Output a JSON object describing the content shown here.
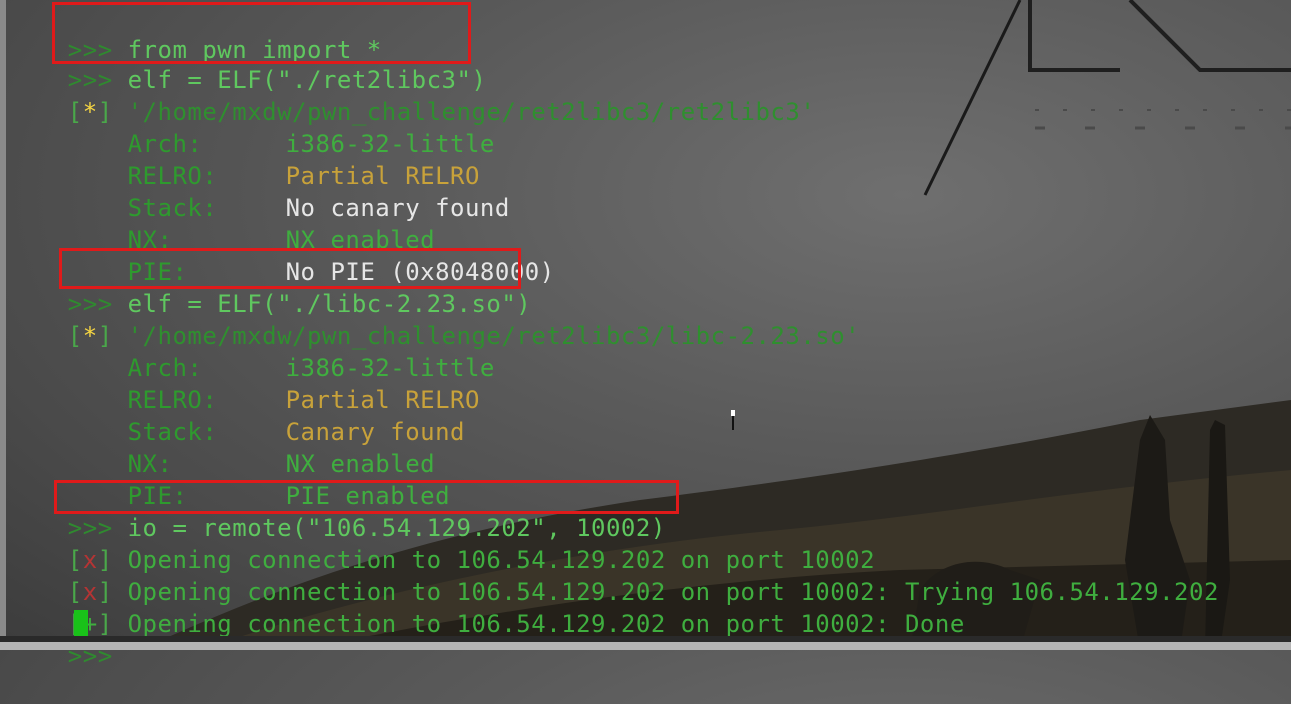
{
  "terminal": {
    "prompt": ">>>",
    "lines": [
      {
        "cmd": "from pwn import *"
      },
      {
        "cmd": "elf = ELF(\"./ret2libc3\")"
      },
      {
        "path": "'/home/mxdw/pwn_challenge/ret2libc3/ret2libc3'"
      },
      {
        "k": "Arch:",
        "v": "i386-32-little"
      },
      {
        "k": "RELRO:",
        "v": "Partial RELRO"
      },
      {
        "k": "Stack:",
        "v": "No canary found"
      },
      {
        "k": "NX:",
        "v": "NX enabled"
      },
      {
        "k": "PIE:",
        "v": "No PIE (0x8048000)"
      },
      {
        "cmd": "elf = ELF(\"./libc-2.23.so\")"
      },
      {
        "path": "'/home/mxdw/pwn_challenge/ret2libc3/libc-2.23.so'"
      },
      {
        "k": "Arch:",
        "v": "i386-32-little"
      },
      {
        "k": "RELRO:",
        "v": "Partial RELRO"
      },
      {
        "k": "Stack:",
        "v": "Canary found"
      },
      {
        "k": "NX:",
        "v": "NX enabled"
      },
      {
        "k": "PIE:",
        "v": "PIE enabled"
      },
      {
        "cmd": "io = remote(\"106.54.129.202\", 10002)"
      },
      {
        "msg": "Opening connection to 106.54.129.202 on port 10002"
      },
      {
        "msg": "Opening connection to 106.54.129.202 on port 10002: Trying 106.54.129.202"
      },
      {
        "msg": "Opening connection to 106.54.129.202 on port 10002: Done"
      }
    ],
    "star": "*",
    "x_mark": "x",
    "plus_mark": "+"
  },
  "colors": {
    "highlight": "#e01a1a",
    "cursor": "#19c219"
  },
  "icons": {
    "mouse": "mouse-pointer-icon"
  }
}
